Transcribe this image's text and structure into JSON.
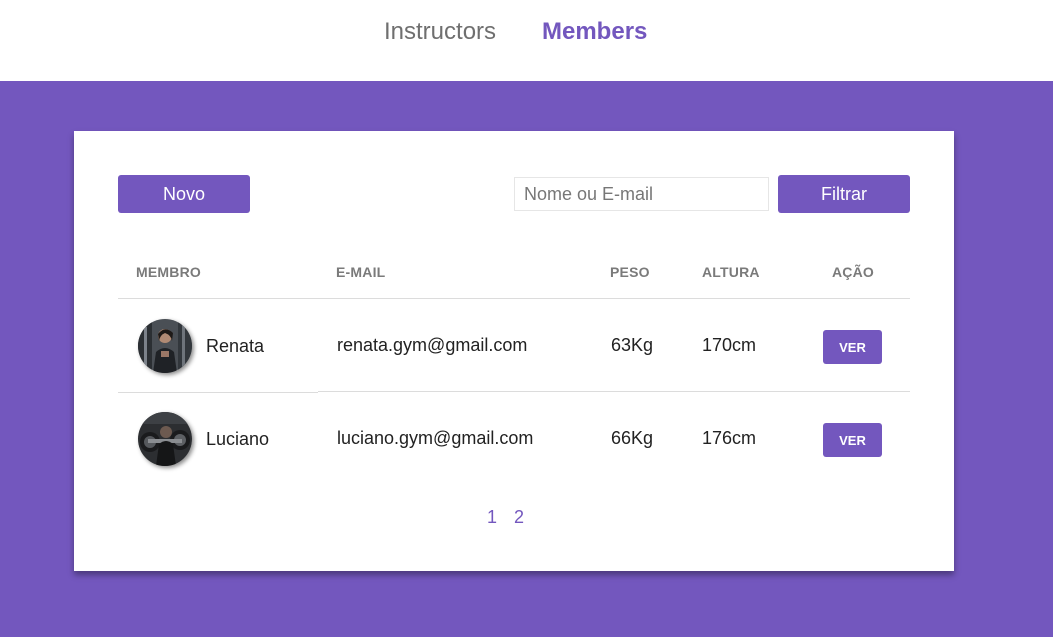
{
  "nav": {
    "items": [
      {
        "label": "Instructors",
        "active": false
      },
      {
        "label": "Members",
        "active": true
      }
    ]
  },
  "toolbar": {
    "new_label": "Novo",
    "search_placeholder": "Nome ou E-mail",
    "search_value": "",
    "filter_label": "Filtrar"
  },
  "table": {
    "headers": [
      "MEMBRO",
      "E-MAIL",
      "PESO",
      "ALTURA",
      "AÇÃO"
    ],
    "rows": [
      {
        "name": "Renata",
        "email": "renata.gym@gmail.com",
        "weight": "63Kg",
        "height": "170cm",
        "action_label": "VER",
        "avatar_icon": "member-photo-renata"
      },
      {
        "name": "Luciano",
        "email": "luciano.gym@gmail.com",
        "weight": "66Kg",
        "height": "176cm",
        "action_label": "VER",
        "avatar_icon": "member-photo-luciano"
      }
    ]
  },
  "pagination": {
    "pages": [
      "1",
      "2"
    ]
  },
  "colors": {
    "accent": "#7357be",
    "header_text": "#7a7a7a",
    "nav_inactive": "#6f6f6f",
    "background": "#ffffff"
  }
}
